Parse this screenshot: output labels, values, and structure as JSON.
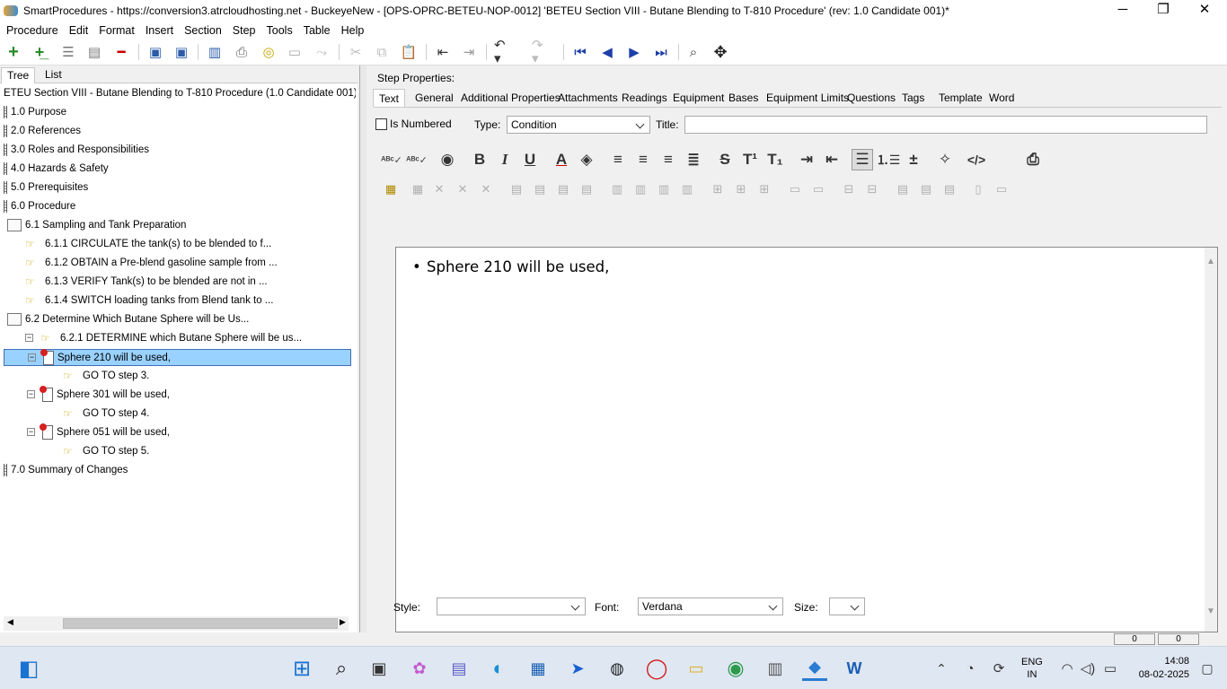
{
  "window": {
    "title": "SmartProcedures - https://conversion3.atrcloudhosting.net - BuckeyeNew - [OPS-OPRC-BETEU-NOP-0012] 'BETEU Section VIII - Butane Blending to T-810 Procedure' (rev: 1.0 Candidate 001)*",
    "minimize": "─",
    "maximize": "❐",
    "close": "✕"
  },
  "menu": [
    "Procedure",
    "Edit",
    "Format",
    "Insert",
    "Section",
    "Step",
    "Tools",
    "Table",
    "Help"
  ],
  "toolbar": {
    "icons": [
      "add-icon",
      "add-child-icon",
      "list-icon",
      "list-alt-icon",
      "remove-icon",
      "save-all-icon",
      "save-icon",
      "database-icon",
      "print-icon",
      "link-icon",
      "window-icon",
      "redo-disabled-icon",
      "cut-icon",
      "copy-icon",
      "paste-icon",
      "outdent-icon",
      "indent-icon",
      "undo-icon",
      "redo-icon",
      "first-icon",
      "previous-icon",
      "next-icon",
      "last-icon",
      "find-icon",
      "move-icon"
    ]
  },
  "left": {
    "tabs": [
      "Tree",
      "List"
    ],
    "tree": [
      {
        "label": "ETEU Section VIII - Butane Blending to T-810 Procedure (1.0 Candidate 001)",
        "icon": "none",
        "indent": 0
      },
      {
        "label": "1.0 Purpose",
        "icon": "page",
        "indent": 0
      },
      {
        "label": "2.0 References",
        "icon": "page",
        "indent": 0
      },
      {
        "label": "3.0 Roles and Responsibilities",
        "icon": "page",
        "indent": 0
      },
      {
        "label": "4.0 Hazards & Safety",
        "icon": "page",
        "indent": 0
      },
      {
        "label": "5.0 Prerequisites",
        "icon": "page",
        "indent": 0
      },
      {
        "label": "6.0 Procedure",
        "icon": "page",
        "indent": 0
      },
      {
        "label": "6.1 Sampling and Tank Preparation",
        "icon": "section",
        "indent": 1
      },
      {
        "label": "6.1.1 CIRCULATE the tank(s) to be blended to f...",
        "icon": "step",
        "indent": 2
      },
      {
        "label": "6.1.2 OBTAIN a Pre-blend gasoline sample from ...",
        "icon": "step",
        "indent": 2
      },
      {
        "label": "6.1.3 VERIFY Tank(s) to be blended are not in ...",
        "icon": "step",
        "indent": 2
      },
      {
        "label": "6.1.4 SWITCH loading tanks from Blend tank to ...",
        "icon": "step",
        "indent": 2
      },
      {
        "label": "6.2 Determine Which Butane Sphere will be Us...",
        "icon": "section",
        "indent": 1
      },
      {
        "label": "6.2.1 DETERMINE which Butane Sphere will be us...",
        "icon": "step",
        "indent": 2,
        "expander": "⊟"
      },
      {
        "label": "Sphere 210 will be used,",
        "icon": "cond",
        "indent": 3,
        "expander": "⊟",
        "selected": true
      },
      {
        "label": "GO TO step 3.",
        "icon": "step",
        "indent": 4
      },
      {
        "label": "Sphere 301 will be used,",
        "icon": "cond",
        "indent": 3,
        "expander": "⊟"
      },
      {
        "label": "GO TO step 4.",
        "icon": "step",
        "indent": 4
      },
      {
        "label": "Sphere 051 will be used,",
        "icon": "cond",
        "indent": 3,
        "expander": "⊟"
      },
      {
        "label": "GO TO step 5.",
        "icon": "step",
        "indent": 4
      },
      {
        "label": "7.0 Summary of Changes",
        "icon": "page",
        "indent": 0
      }
    ]
  },
  "right": {
    "header": "Step Properties:",
    "tabs": [
      "Text",
      "General",
      "Additional Properties",
      "Attachments",
      "Readings",
      "Equipment",
      "Bases",
      "Equipment Limits",
      "Questions",
      "Tags",
      "Template",
      "Word"
    ],
    "is_numbered_label": "Is Numbered",
    "type_label": "Type:",
    "type_value": "Condition",
    "title_label": "Title:",
    "title_value": "",
    "editor_text": "Sphere 210 will be used,",
    "style_label": "Style:",
    "style_value": "",
    "font_label": "Font:",
    "font_value": "Verdana",
    "size_label": "Size:",
    "size_value": ""
  },
  "status": {
    "left": "0",
    "right": "0"
  },
  "taskbar": {
    "lang_line1": "ENG",
    "lang_line2": "IN",
    "time": "14:08",
    "date": "08-02-2025"
  }
}
